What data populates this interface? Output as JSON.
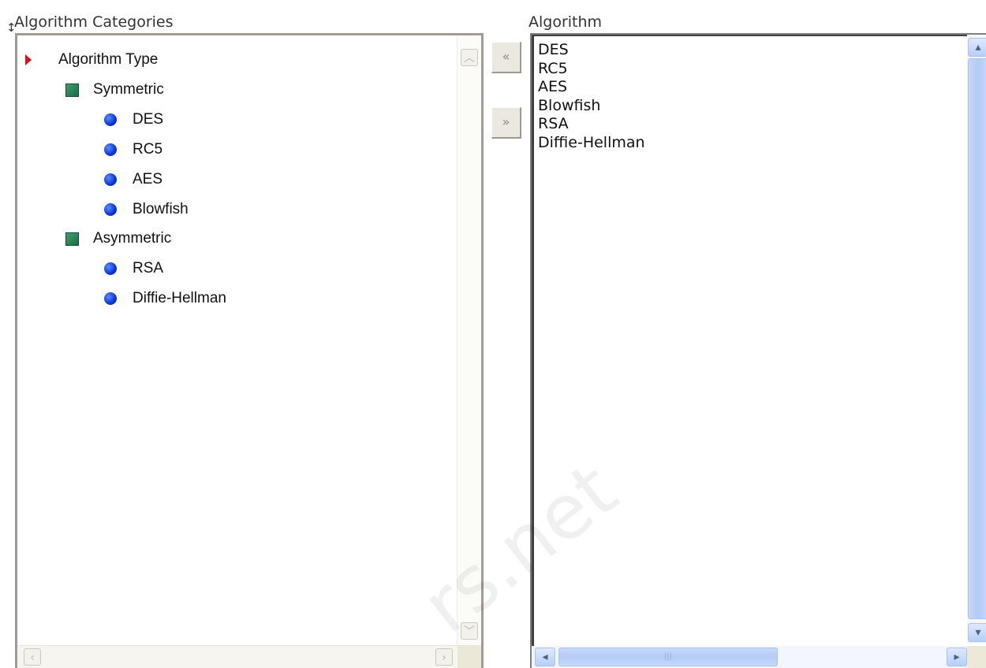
{
  "labels": {
    "categories": "Algorithm Categories",
    "algorithm": "Algorithm"
  },
  "tree": {
    "root": {
      "label": "Algorithm Type",
      "icon": "red-arrow-icon"
    },
    "groups": [
      {
        "label": "Symmetric",
        "icon": "green-square-icon",
        "items": [
          "DES",
          "RC5",
          "AES",
          "Blowfish"
        ]
      },
      {
        "label": "Asymmetric",
        "icon": "green-square-icon",
        "items": [
          "RSA",
          "Diffie-Hellman"
        ]
      }
    ]
  },
  "buttons": {
    "move_left": "«",
    "move_right": "»"
  },
  "algorithm_list": [
    "DES",
    "RC5",
    "AES",
    "Blowfish",
    "RSA",
    "Diffie-Hellman"
  ],
  "watermark": "rs.net",
  "colors": {
    "arrow": "#d2141c",
    "folder": "#2a7d55",
    "bullet": "#0a33d8",
    "scroll_accent": "#b4cbf6"
  }
}
